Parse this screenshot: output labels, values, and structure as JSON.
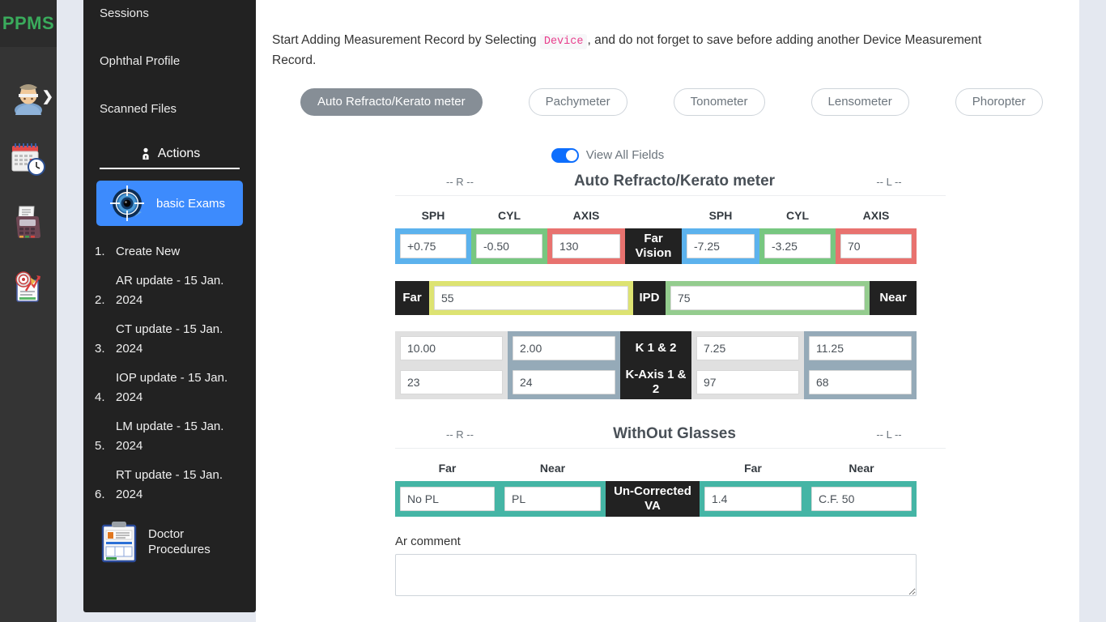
{
  "brand": {
    "logo": "PPMS"
  },
  "rail": {
    "items": [
      {
        "name": "patient-icon",
        "label": "Patients"
      },
      {
        "name": "appointments-icon",
        "label": "Appointments"
      },
      {
        "name": "billing-icon",
        "label": "Billing"
      },
      {
        "name": "reports-icon",
        "label": "Reports"
      }
    ],
    "chevron": "❯"
  },
  "sidebar": {
    "links": [
      {
        "label": "Sessions"
      },
      {
        "label": "Ophthal Profile"
      },
      {
        "label": "Scanned Files"
      }
    ],
    "actions_header": "Actions",
    "active_item": {
      "label": "basic Exams",
      "icon": "eye-target-icon"
    },
    "numbered_items": [
      {
        "num": "1.",
        "label": "Create New",
        "single": true
      },
      {
        "num": "2.",
        "label": "AR update - 15 Jan. 2024",
        "single": false
      },
      {
        "num": "3.",
        "label": "CT update - 15 Jan. 2024",
        "single": false
      },
      {
        "num": "4.",
        "label": "IOP update - 15 Jan. 2024",
        "single": false
      },
      {
        "num": "5.",
        "label": "LM update - 15 Jan. 2024",
        "single": false
      },
      {
        "num": "6.",
        "label": "RT update - 15 Jan. 2024",
        "single": false
      }
    ],
    "doctor_procedures": {
      "label": "Doctor Procedures",
      "icon": "clipboard-icon"
    }
  },
  "main": {
    "intro_part1": "Start Adding Measurement Record by Selecting",
    "intro_code": "Device",
    "intro_part2": ", and do not forget to save before adding another Device Measurement Record.",
    "devices": [
      {
        "label": "Auto Refracto/Kerato meter",
        "active": true
      },
      {
        "label": "Pachymeter",
        "active": false
      },
      {
        "label": "Tonometer",
        "active": false
      },
      {
        "label": "Lensometer",
        "active": false
      },
      {
        "label": "Phoropter",
        "active": false
      }
    ],
    "view_all_fields": {
      "label": "View All Fields",
      "on": true
    },
    "ar_section": {
      "title": "Auto Refracto/Kerato meter",
      "right_label": "-- R --",
      "left_label": "-- L --",
      "col_headers": [
        "SPH",
        "CYL",
        "AXIS",
        "",
        "SPH",
        "CYL",
        "AXIS"
      ],
      "far_vision_label": "Far Vision",
      "values": {
        "r_sph": "+0.75",
        "r_cyl": "-0.50",
        "r_axis": "130",
        "l_sph": "-7.25",
        "l_cyl": "-3.25",
        "l_axis": "70"
      },
      "ipd_row": {
        "far_label": "Far",
        "far_value": "55",
        "ipd_label": "IPD",
        "ipd_value": "75",
        "near_label": "Near"
      },
      "k_rows": {
        "k_label": "K 1 & 2",
        "kaxis_label": "K-Axis 1 & 2",
        "r_k1": "10.00",
        "r_k2": "2.00",
        "l_k1": "7.25",
        "l_k2": "11.25",
        "r_ka1": "23",
        "r_ka2": "24",
        "l_ka1": "97",
        "l_ka2": "68"
      }
    },
    "wog_section": {
      "title": "WithOut Glasses",
      "right_label": "-- R --",
      "left_label": "-- L --",
      "col_headers": [
        "Far",
        "Near",
        "",
        "Far",
        "Near"
      ],
      "mid_label": "Un-Corrected VA",
      "values": {
        "r_far": "No PL",
        "r_near": "PL",
        "l_far": "1.4",
        "l_near": "C.F. 50"
      }
    },
    "comment": {
      "label": "Ar comment",
      "value": "",
      "placeholder": ""
    }
  },
  "colors": {
    "accent_blue": "#3d8bfd",
    "toggle_on": "#0d6efd",
    "brand_green": "#3aab5c",
    "code_pink": "#e83e8c",
    "sph_blue": "#5cb2ed",
    "cyl_green": "#77c780",
    "axis_red": "#e8726f",
    "far_yellow": "#dde372",
    "ipd_green": "#94cc8e",
    "va_teal": "#45b5a5",
    "k_gray": "#e0e0e0",
    "k_slate": "#95aab8",
    "dark": "#222222"
  }
}
